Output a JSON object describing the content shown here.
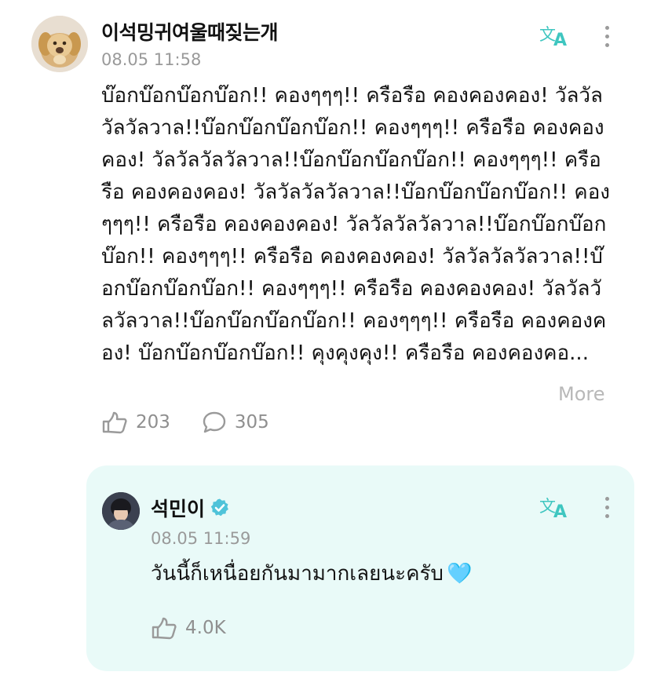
{
  "post": {
    "author_name": "이석밍귀여울때짖는개",
    "timestamp": "08.05 11:58",
    "body": "บ๊อกบ๊อกบ๊อกบ๊อก!! คองๆๆๆ!! ครือรือ คองคองคอง! วัลวัลวัลวัลวาล!!บ๊อกบ๊อกบ๊อกบ๊อก!! คองๆๆๆ!! ครือรือ คองคองคอง! วัลวัลวัลวัลวาล!!บ๊อกบ๊อกบ๊อกบ๊อก!! คองๆๆๆ!! ครือรือ คองคองคอง! วัลวัลวัลวัลวาล!!บ๊อกบ๊อกบ๊อกบ๊อก!! คองๆๆๆ!! ครือรือ คองคองคอง! วัลวัลวัลวัลวาล!!บ๊อกบ๊อกบ๊อกบ๊อก!! คองๆๆๆ!! ครือรือ คองคองคอง! วัลวัลวัลวัลวาล!!บ๊อกบ๊อกบ๊อกบ๊อก!! คองๆๆๆ!! ครือรือ คองคองคอง! วัลวัลวัลวัลวาล!!บ๊อกบ๊อกบ๊อกบ๊อก!! คองๆๆๆ!! ครือรือ คองคองคอง! บ๊อกบ๊อกบ๊อกบ๊อก!! คุงคุงคุง!! ครือรือ คองคองคอ...",
    "more_label": "More",
    "like_count": "203",
    "comment_count": "305"
  },
  "reply": {
    "author_name": "석민이",
    "timestamp": "08.05 11:59",
    "body": "วันนี้ก็เหนื่อยกันมามากเลยนะครับ",
    "emoji": "🩵",
    "like_count": "4.0K"
  },
  "colors": {
    "accent": "#3fc6c0",
    "reply_bg": "#e9faf8",
    "muted_text": "#9a9a9a",
    "verified_badge": "#4fc3d9"
  },
  "icons": {
    "translate": "translate-icon",
    "more": "more-vertical-icon",
    "like": "like-hand-icon",
    "comment": "comment-bubble-icon",
    "verified": "verified-badge-icon"
  }
}
